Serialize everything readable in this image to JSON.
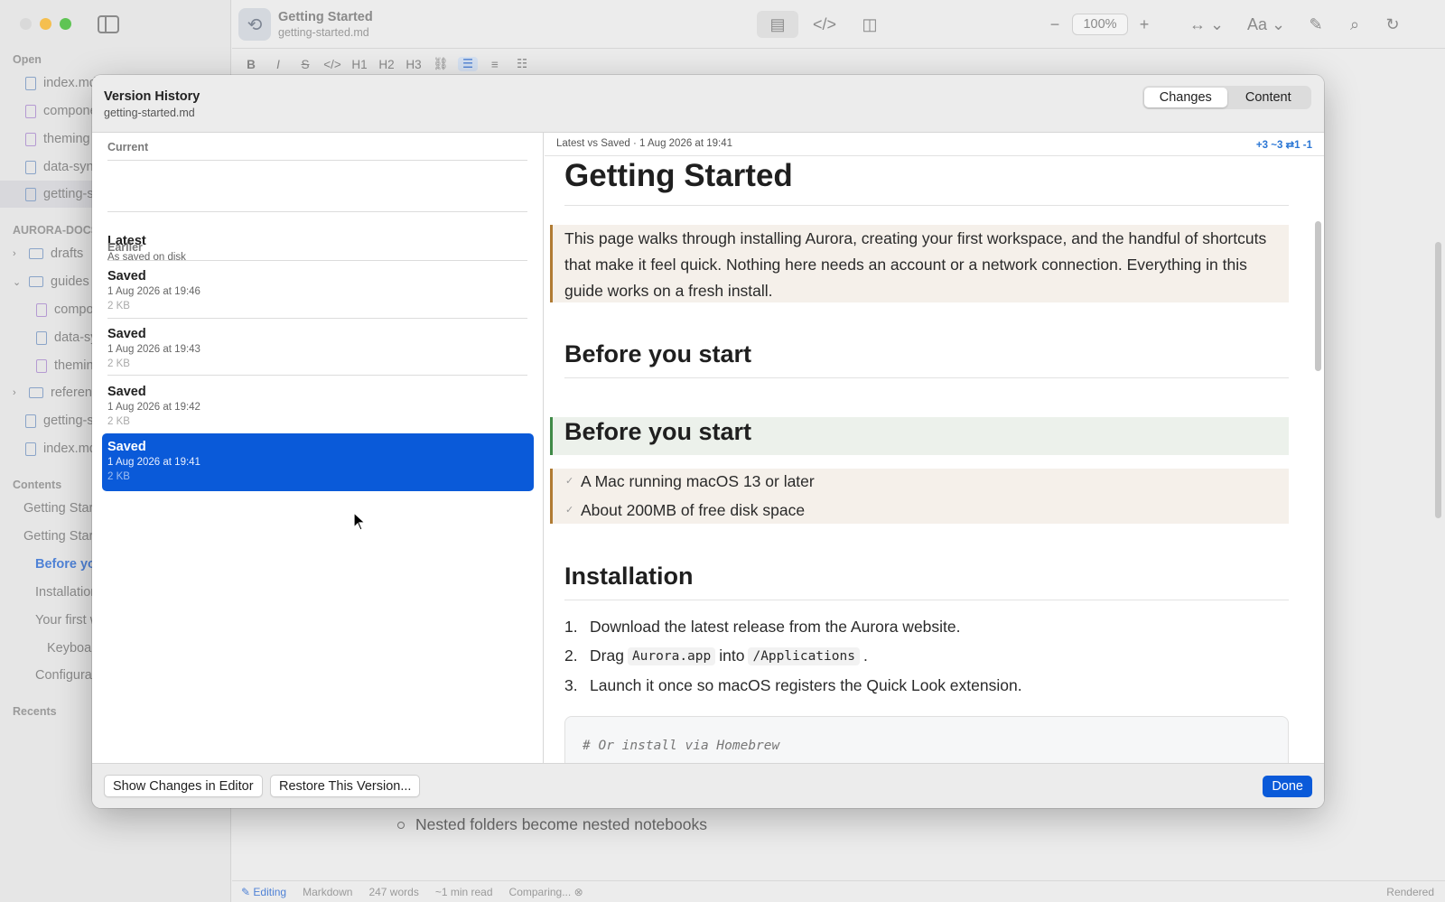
{
  "app": {
    "doc_title": "Getting Started",
    "doc_file": "getting-started.md",
    "zoom": "100%",
    "font_menu": "Aa",
    "format_bar": [
      "B",
      "I",
      "S",
      "</>",
      "H1",
      "H2",
      "H3"
    ],
    "sidebar": {
      "open_label": "Open",
      "open_files": [
        {
          "name": "index.md",
          "type": "doc"
        },
        {
          "name": "components",
          "type": "comp"
        },
        {
          "name": "theming",
          "type": "comp"
        },
        {
          "name": "data-sync",
          "type": "doc"
        },
        {
          "name": "getting-started.md",
          "type": "doc"
        }
      ],
      "workspace_label": "AURORA-DOCS",
      "tree": [
        {
          "name": "drafts",
          "type": "folder",
          "expanded": false
        },
        {
          "name": "guides",
          "type": "folder",
          "expanded": true
        },
        {
          "name": "components",
          "type": "comp"
        },
        {
          "name": "data-sync",
          "type": "doc"
        },
        {
          "name": "theming",
          "type": "comp"
        },
        {
          "name": "reference",
          "type": "folder",
          "expanded": false
        },
        {
          "name": "getting-started.md",
          "type": "doc"
        },
        {
          "name": "index.md",
          "type": "doc"
        }
      ],
      "contents_label": "Contents",
      "toc": [
        "Getting Started",
        "Getting Started",
        "Before you start",
        "Installation",
        "Your first workspace",
        "Keyboard shortcuts",
        "Configuration"
      ],
      "recents_label": "Recents"
    },
    "background_doc_line": "Nested folders become nested notebooks",
    "status": {
      "mode": "Editing",
      "format": "Markdown",
      "words": "247 words",
      "read_time": "~1 min read",
      "comparing": "Comparing...",
      "view": "Rendered"
    }
  },
  "sheet": {
    "title": "Version History",
    "subtitle": "getting-started.md",
    "tabs": {
      "changes": "Changes",
      "content": "Content"
    },
    "list": {
      "current_label": "Current",
      "latest": {
        "title": "Latest",
        "subtitle": "As saved on disk"
      },
      "earlier_label": "Earlier",
      "versions": [
        {
          "title": "Saved",
          "date": "1 Aug 2026 at 19:46",
          "size": "2 KB"
        },
        {
          "title": "Saved",
          "date": "1 Aug 2026 at 19:43",
          "size": "2 KB"
        },
        {
          "title": "Saved",
          "date": "1 Aug 2026 at 19:42",
          "size": "2 KB"
        },
        {
          "title": "Saved",
          "date": "1 Aug 2026 at 19:41",
          "size": "2 KB"
        }
      ]
    },
    "diff": {
      "info": "Latest vs Saved · 1 Aug 2026 at 19:41",
      "stats": "+3 ~3 ⇄1 -1",
      "h1": "Getting Started",
      "intro": "This page walks through installing Aurora, creating your first workspace, and the handful of shortcuts that make it feel quick. Nothing here needs an account or a network connection. Everything in this guide works on a fresh install.",
      "h2_before_removed": "Before you start",
      "h2_before_added": "Before you start",
      "tasks": [
        "A Mac running macOS 13 or later",
        "About 200MB of free disk space"
      ],
      "h2_install": "Installation",
      "steps": {
        "s1": "Download the latest release from the Aurora website.",
        "s2_pre": "Drag",
        "s2_code1": "Aurora.app",
        "s2_mid": "into",
        "s2_code2": "/Applications",
        "s2_post": ".",
        "s3": "Launch it once so macOS registers the Quick Look extension."
      },
      "code_comment": "# Or install via Homebrew"
    },
    "footer": {
      "show_changes": "Show Changes in Editor",
      "restore": "Restore This Version...",
      "done": "Done"
    },
    "colors": {
      "accent": "#0a5ad9",
      "modified": "#b07b33",
      "added": "#3f8a47"
    }
  }
}
